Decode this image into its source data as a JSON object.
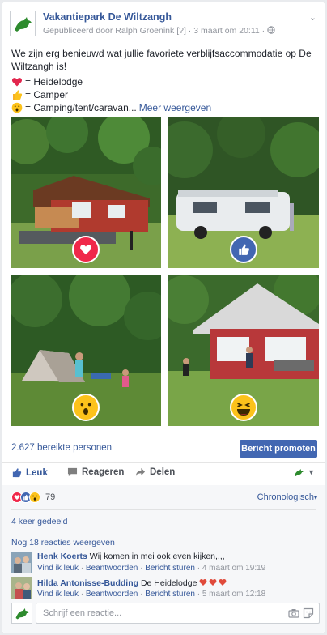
{
  "post": {
    "page_name": "Vakantiepark De Wiltzangh",
    "published_by": "Gepubliceerd door Ralph Groenink",
    "help_marker": "[?]",
    "date": "3 maart om 20:11",
    "text": "We zijn erg benieuwd wat jullie favoriete verblijfsaccommodatie op De Wiltzangh is!",
    "legend": [
      {
        "icon": "heart-emoji",
        "text": "= Heidelodge"
      },
      {
        "icon": "thumbs-up-emoji",
        "text": "= Camper"
      },
      {
        "icon": "wow-emoji",
        "text": "= Camping/tent/caravan..."
      }
    ],
    "see_more": "Meer weergeven"
  },
  "photos": [
    {
      "subject": "Heidelodge",
      "reaction": "love"
    },
    {
      "subject": "Camper",
      "reaction": "like"
    },
    {
      "subject": "Camping/tent/caravan",
      "reaction": "wow"
    },
    {
      "subject": "Chalet",
      "reaction": "haha"
    }
  ],
  "stats": {
    "reach": "2.627 bereikte personen",
    "promote_label": "Bericht promoten"
  },
  "actions": {
    "like": "Leuk",
    "comment": "Reageren",
    "share": "Delen"
  },
  "reactions": {
    "count": "79",
    "order_label": "Chronologisch",
    "shares": "4 keer gedeeld",
    "view_more": "Nog 18 reacties weergeven"
  },
  "comments": [
    {
      "author": "Henk Koerts",
      "text": "Wij komen in mei ook even kijken,,,,",
      "like": "Vind ik leuk",
      "reply": "Beantwoorden",
      "message": "Bericht sturen",
      "time": "4 maart om 19:19"
    },
    {
      "author": "Hilda Antonisse-Budding",
      "text": "De Heidelodge",
      "like": "Vind ik leuk",
      "reply": "Beantwoorden",
      "message": "Bericht sturen",
      "time": "5 maart om 12:18"
    }
  ],
  "composer": {
    "placeholder": "Schrijf een reactie..."
  },
  "colors": {
    "link": "#365899",
    "brand_green": "#2e8b2e",
    "love": "#f0284a",
    "like": "#4267b2",
    "wow": "#f7b125",
    "promote_bg": "#4267b2"
  }
}
